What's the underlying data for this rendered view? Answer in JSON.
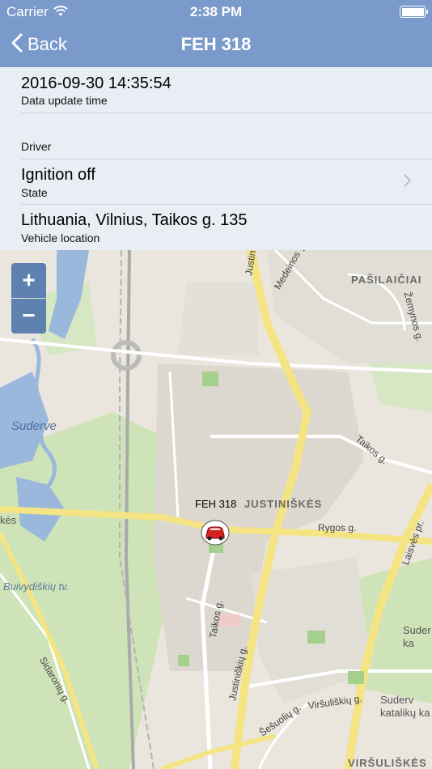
{
  "status_bar": {
    "carrier": "Carrier",
    "time": "2:38 PM"
  },
  "nav": {
    "back_label": "Back",
    "title": "FEH 318"
  },
  "details": {
    "update_time_value": "2016-09-30 14:35:54",
    "update_time_label": "Data update time",
    "driver_label": "Driver",
    "state_value": "Ignition off",
    "state_label": "State",
    "location_value": "Lithuania, Vilnius, Taikos g. 135",
    "location_label": "Vehicle location"
  },
  "map": {
    "zoom_in": "+",
    "zoom_out": "−",
    "vehicle_label": "FEH 318",
    "labels": {
      "pasilaiciai": "PAŠILAIČIAI",
      "justiniskes": "JUSTINIŠKĖS",
      "justinisk_top": "Justiniški",
      "medeinos": "Medeinos g.",
      "zemynos": "Žemynos g.",
      "suderve": "Suderve",
      "taikos_ne": "Taikos g.",
      "rygos": "Rygos g.",
      "laisves": "Laisvės pr.",
      "kes": "kės",
      "buivydiskiu": "Buivydiškių tv.",
      "taikos_s": "Taikos g.",
      "justinisku": "Justiniškių g.",
      "sidaroniu": "Sidaronių g.",
      "sesuoliu": "Šešuolių g.",
      "virsuliskiu": "Viršuliškių g.",
      "suder_ka": "Suder ka",
      "suderves_kat": "Suderv katalikų ka",
      "virsuliskes": "VIRŠULIŠKĖS"
    },
    "colors": {
      "background": "#eae6dd",
      "park": "#c8dfb0",
      "water": "#9ab8dc",
      "major_road": "#f4e483",
      "residential": "#d9d5cc"
    }
  }
}
